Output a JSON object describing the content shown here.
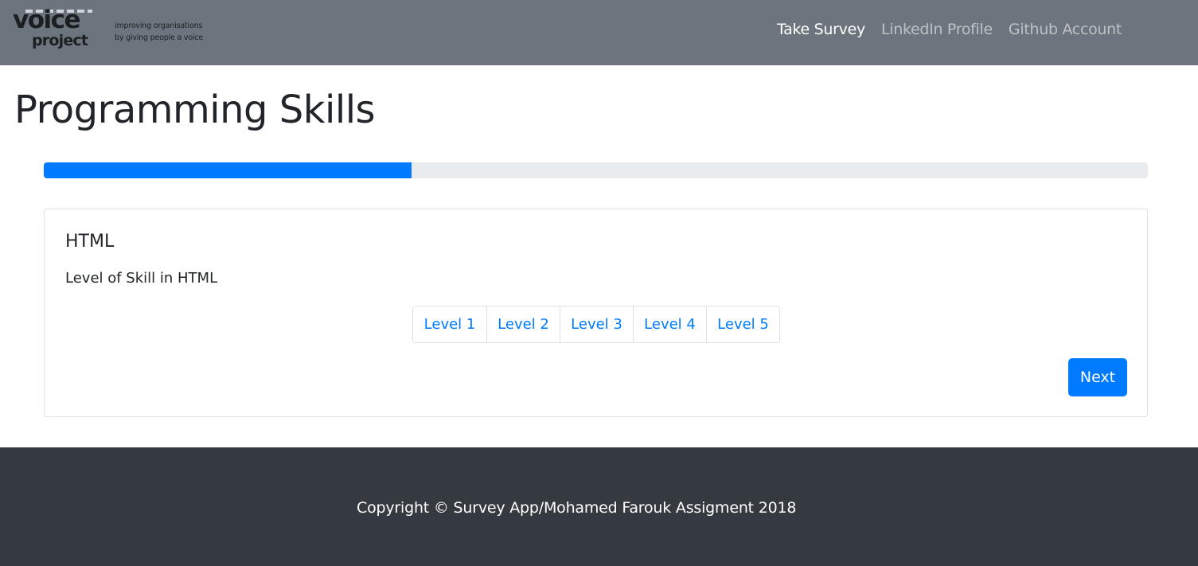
{
  "navbar": {
    "logo": {
      "word1": "voice",
      "word2": "project",
      "tagline_line1": "improving organisations",
      "tagline_line2": "by giving people a voice"
    },
    "links": [
      {
        "label": "Take Survey",
        "active": true
      },
      {
        "label": "LinkedIn Profile",
        "active": false
      },
      {
        "label": "Github Account",
        "active": false
      }
    ]
  },
  "page": {
    "title": "Programming Skills",
    "progress_percent": 33.3
  },
  "question": {
    "title": "HTML",
    "text": "Level of Skill in HTML",
    "levels": [
      "Level 1",
      "Level 2",
      "Level 3",
      "Level 4",
      "Level 5"
    ],
    "next_label": "Next"
  },
  "footer": {
    "text": "Copyright © Survey App/Mohamed Farouk Assigment 2018"
  },
  "colors": {
    "navbar_bg": "#6c757d",
    "primary": "#007bff",
    "footer_bg": "#343a40",
    "progress_track": "#e9ecef"
  }
}
